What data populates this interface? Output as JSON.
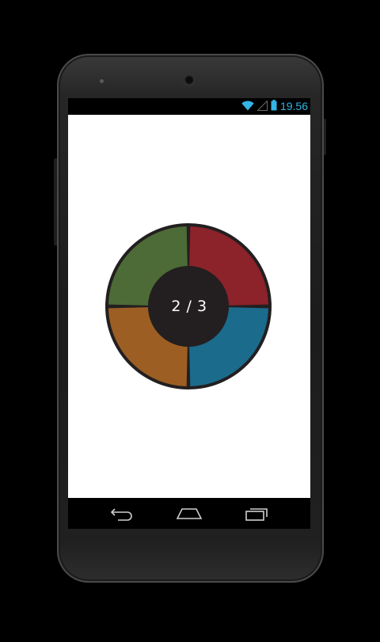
{
  "status_bar": {
    "time": "19.56",
    "icons": [
      "wifi-icon",
      "cell-signal-icon",
      "battery-icon"
    ],
    "accent_color": "#33b5e5"
  },
  "game": {
    "progress_label": "2 / 3",
    "pads": [
      {
        "name": "top-left",
        "color": "#4d6b36"
      },
      {
        "name": "top-right",
        "color": "#8c222a"
      },
      {
        "name": "bottom-right",
        "color": "#1b6b8c"
      },
      {
        "name": "bottom-left",
        "color": "#9c5e23"
      }
    ],
    "center_color": "#231f20",
    "outline_color": "#231f20"
  },
  "nav_bar": {
    "icons": [
      "back-icon",
      "home-icon",
      "recent-apps-icon"
    ]
  }
}
